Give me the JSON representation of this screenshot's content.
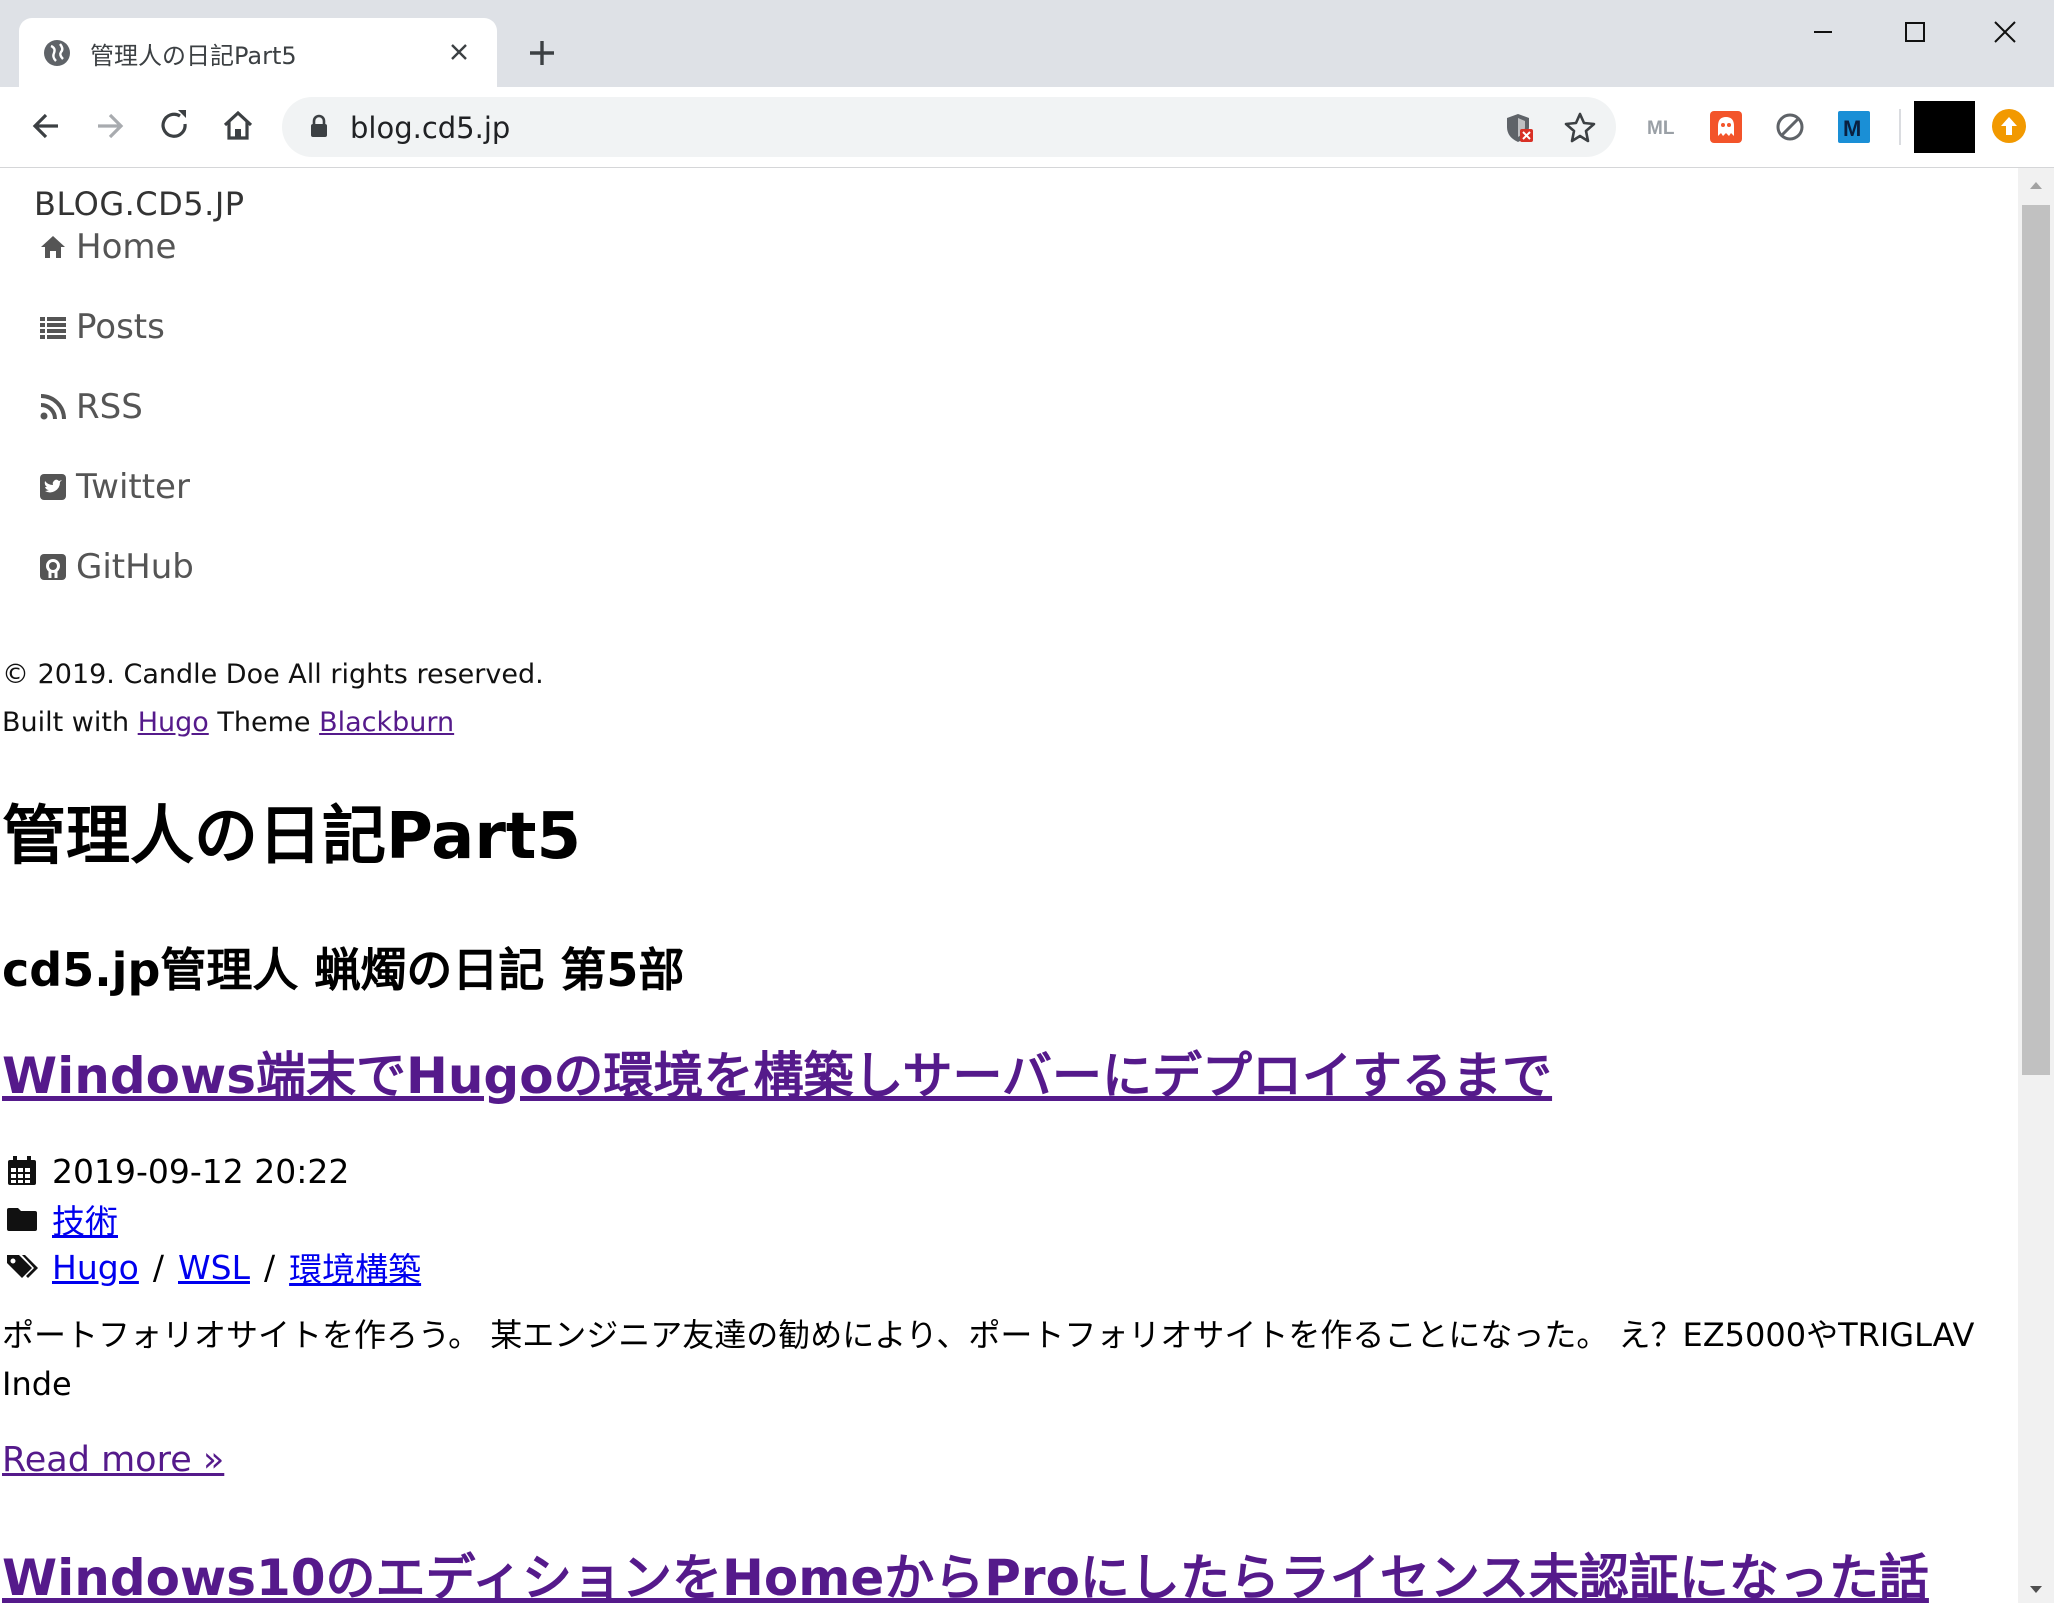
{
  "browser": {
    "tab_title": "管理人の日記Part5",
    "url": "blog.cd5.jp"
  },
  "extensions": [
    "ML",
    "ghostery",
    "block",
    "M"
  ],
  "site": {
    "brand": "BLOG.CD5.JP",
    "menu": [
      {
        "label": "Home",
        "icon": "home-icon"
      },
      {
        "label": "Posts",
        "icon": "list-icon"
      },
      {
        "label": "RSS",
        "icon": "rss-icon"
      },
      {
        "label": "Twitter",
        "icon": "twitter-icon"
      },
      {
        "label": "GitHub",
        "icon": "github-icon"
      }
    ],
    "footer": {
      "copyright": "© 2019. Candle Doe All rights reserved.",
      "built_with": "Built with",
      "hugo": "Hugo",
      "theme": "Theme",
      "blackburn": "Blackburn"
    },
    "title": "管理人の日記Part5",
    "subtitle": "cd5.jp管理人 蝋燭の日記 第5部"
  },
  "posts": [
    {
      "title": "Windows端末でHugoの環境を構築しサーバーにデプロイするまで",
      "date": "2019-09-12 20:22",
      "category": "技術",
      "tags": [
        "Hugo",
        "WSL",
        "環境構築"
      ],
      "tag_sep": "/",
      "summary": "ポートフォリオサイトを作ろう。 某エンジニア友達の勧めにより、ポートフォリオサイトを作ることになった。 え？EZ5000やTRIGLAV Inde",
      "read_more": "Read more »"
    },
    {
      "title": "Windows10のエディションをHomeからProにしたらライセンス未認証になった話"
    }
  ]
}
